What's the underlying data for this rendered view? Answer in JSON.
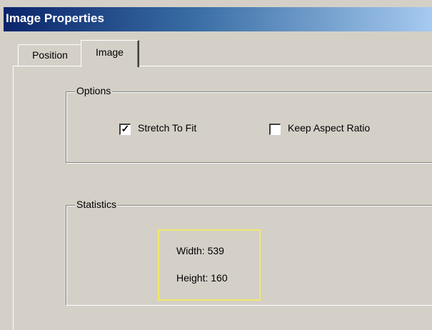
{
  "window": {
    "title": "Image Properties"
  },
  "tabs": [
    {
      "label": "Position",
      "selected": false
    },
    {
      "label": "Image",
      "selected": true
    }
  ],
  "options": {
    "group_label": "Options",
    "stretch_to_fit": {
      "label": "Stretch To Fit",
      "checked": true
    },
    "keep_aspect_ratio": {
      "label": "Keep Aspect Ratio",
      "checked": false
    }
  },
  "statistics": {
    "group_label": "Statistics",
    "width_text": "Width: 539",
    "height_text": "Height: 160",
    "highlight_color": "#f0e86a"
  },
  "colors": {
    "dialog_face": "#d4d0c8",
    "titlebar_start": "#0a246a",
    "titlebar_end": "#a6caf0"
  }
}
